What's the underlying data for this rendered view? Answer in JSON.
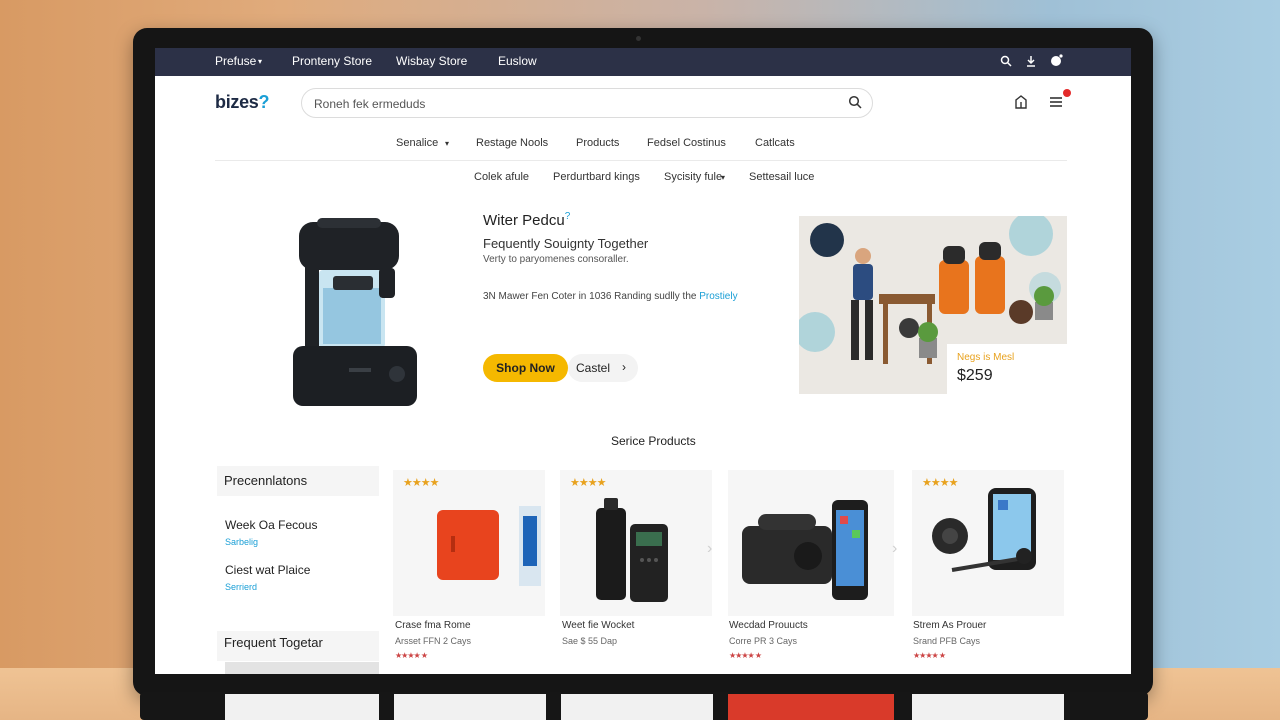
{
  "topbar": {
    "nav": [
      "Prefuse",
      "Pronteny Store",
      "Wisbay Store",
      "Euslow"
    ]
  },
  "header": {
    "logo_main": "bizes",
    "logo_mark": "?",
    "search_placeholder": "Roneh fek ermeduds"
  },
  "categories": [
    "Senalice",
    "Restage Nools",
    "Products",
    "Fedsel Costinus",
    "Catlcats"
  ],
  "subcategories": [
    "Colek afule",
    "Perdurtbard kings",
    "Sycisity fule",
    "Settesail luce"
  ],
  "hero": {
    "title": "Witer Pedcu",
    "title_mark": "?",
    "subtitle": "Fequently Souignty Together",
    "description": "Verty to paryomenes consoraller.",
    "line_text": "3N Mawer Fen Coter in 1036 Randing sudlly the ",
    "line_link": "Prostiely",
    "shop_button": "Shop Now",
    "cart_button": "Castel",
    "cart_chevron": "›"
  },
  "promo": {
    "tag": "Negs is Mesl",
    "price": "$259"
  },
  "section_title": "Serice Products",
  "sidebar": {
    "heading": "Precennlatons",
    "items": [
      {
        "title": "Week Oa Fecous",
        "link": "Sarbelig"
      },
      {
        "title": "Ciest wat Plaice",
        "link": "Serrierd"
      }
    ],
    "heading2": "Frequent Togetar"
  },
  "products": [
    {
      "stars": "★★★★",
      "name": "Crase fma Rome",
      "meta": "Arsset FFN 2 Cays",
      "rating": "★★★★ ★"
    },
    {
      "stars": "★★★★",
      "name": "Weet fie Wocket",
      "meta": "Sae $ 55 Dap",
      "rating": ""
    },
    {
      "stars": "",
      "name": "Wecdad Prouucts",
      "meta": "Corre PR 3 Cays",
      "rating": "★★★★ ★"
    },
    {
      "stars": "★★★★",
      "name": "Strem As Prouer",
      "meta": "Srand PFB Cays",
      "rating": "★★★★ ★"
    }
  ],
  "colors": {
    "topbar": "#2c3147",
    "accent_button": "#f5b800",
    "link": "#1a9fd6",
    "star": "#e8a21e"
  }
}
